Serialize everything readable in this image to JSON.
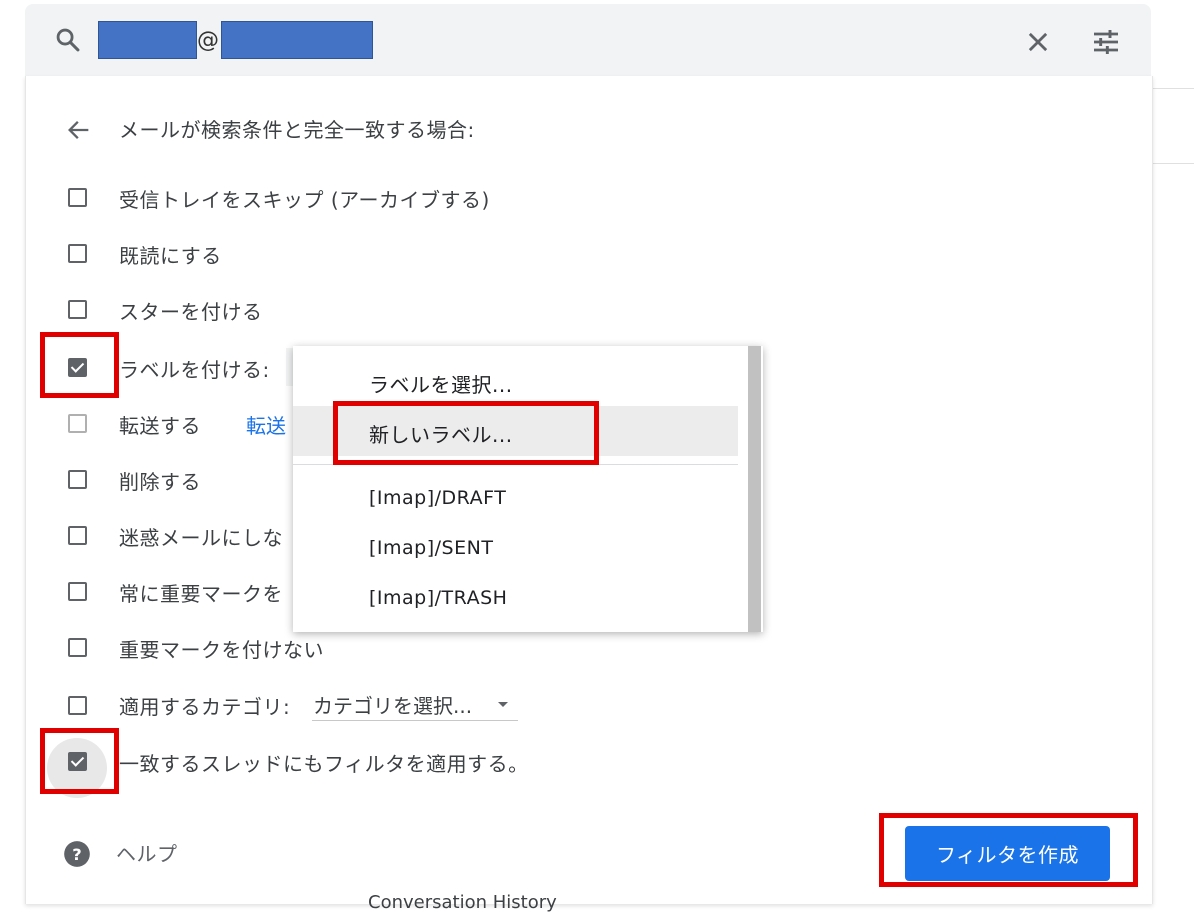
{
  "search": {
    "at_sign": "@",
    "redacted_color": "#4472c4"
  },
  "filter": {
    "heading": "メールが検索条件と完全一致する場合:",
    "options": [
      {
        "label": "受信トレイをスキップ (アーカイブする)",
        "checked": false
      },
      {
        "label": "既読にする",
        "checked": false
      },
      {
        "label": "スターを付ける",
        "checked": false
      },
      {
        "label": "ラベルを付ける:",
        "checked": true
      },
      {
        "label": "転送する",
        "checked": false,
        "link": "転送"
      },
      {
        "label": "削除する",
        "checked": false
      },
      {
        "label": "迷惑メールにしな",
        "checked": false
      },
      {
        "label": "常に重要マークを",
        "checked": false
      },
      {
        "label": "重要マークを付けない",
        "checked": false
      },
      {
        "label": "適用するカテゴリ:",
        "checked": false
      },
      {
        "label": "一致するスレッドにもフィルタを適用する。",
        "checked": true
      }
    ],
    "category_select": "カテゴリを選択...",
    "help": "ヘルプ",
    "create_button": "フィルタを作成",
    "behind_text": "Conversation History"
  },
  "label_dropdown": {
    "items": [
      "ラベルを選択...",
      "新しいラベル...",
      "[Imap]/DRAFT",
      "[Imap]/SENT",
      "[Imap]/TRASH"
    ]
  },
  "colors": {
    "accent": "#1a73e8",
    "highlight_box": "#e00000"
  }
}
